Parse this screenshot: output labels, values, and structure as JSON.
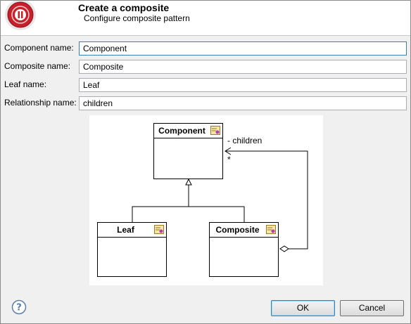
{
  "header": {
    "title": "Create a composite",
    "subtitle": "Configure composite pattern"
  },
  "form": {
    "fields": [
      {
        "label": "Component name:",
        "value": "Component"
      },
      {
        "label": "Composite name:",
        "value": "Composite"
      },
      {
        "label": "Leaf name:",
        "value": "Leaf"
      },
      {
        "label": "Relationship name:",
        "value": "children"
      }
    ]
  },
  "diagram": {
    "classes": [
      {
        "name": "Component"
      },
      {
        "name": "Leaf"
      },
      {
        "name": "Composite"
      }
    ],
    "association_label": "- children",
    "multiplicity": "*"
  },
  "buttons": {
    "ok": "OK",
    "cancel": "Cancel"
  },
  "icons": {
    "header": "composite-wizard-icon",
    "help": "help-icon",
    "class": "uml-class-icon"
  },
  "colors": {
    "header_icon_red": "#c8202a",
    "focus_border": "#3c7fb1",
    "help_blue": "#5b7fa8"
  }
}
